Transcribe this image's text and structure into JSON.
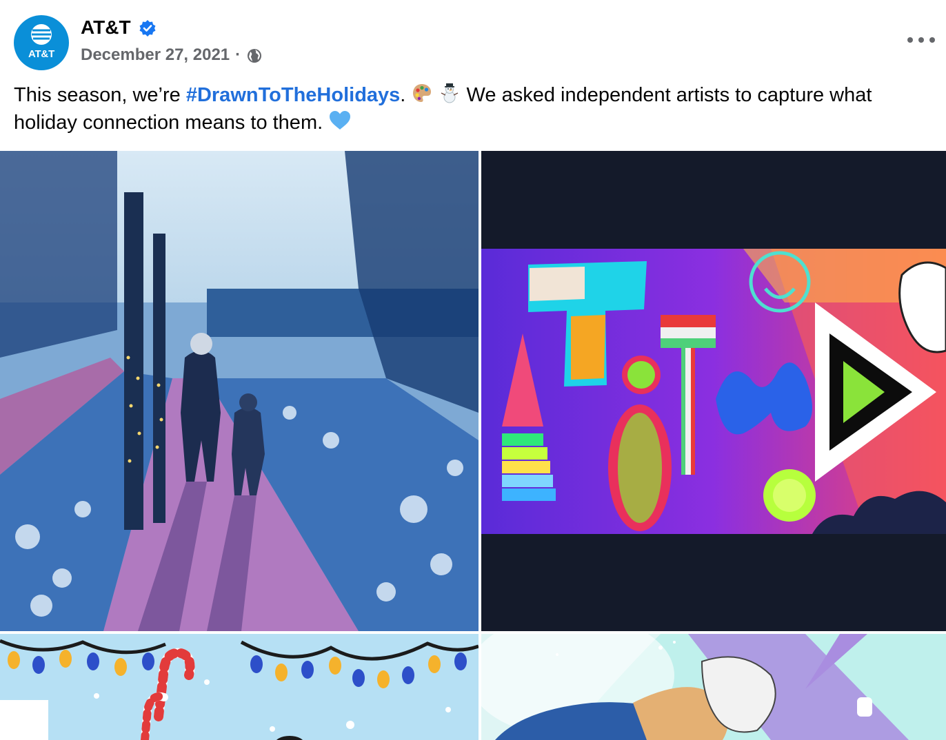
{
  "post": {
    "author": "AT&T",
    "avatar_text": "AT&T",
    "verified": true,
    "date": "December 27, 2021",
    "separator": "·",
    "audience_icon": "globe-icon",
    "more_icon": "more-options-icon",
    "caption": {
      "before": "This season, we’re ",
      "hashtag": "#DrawnToTheHolidays",
      "after_hashtag": ".",
      "emoji_1": "palette-icon",
      "emoji_2": "snowman-icon",
      "middle": " We asked independent artists to capture what holiday connection means to them.",
      "emoji_3": "blue-heart-icon"
    },
    "images": [
      {
        "name": "winter-walk-painting"
      },
      {
        "name": "colorful-att-letters-art"
      },
      {
        "name": "holiday-lights-candy-cane-art"
      },
      {
        "name": "illustrated-figure-art"
      }
    ]
  },
  "colors": {
    "brand_blue": "#0a8fd8",
    "hashtag": "#216fdb",
    "meta_gray": "#65676b",
    "verified": "#1877f2"
  }
}
